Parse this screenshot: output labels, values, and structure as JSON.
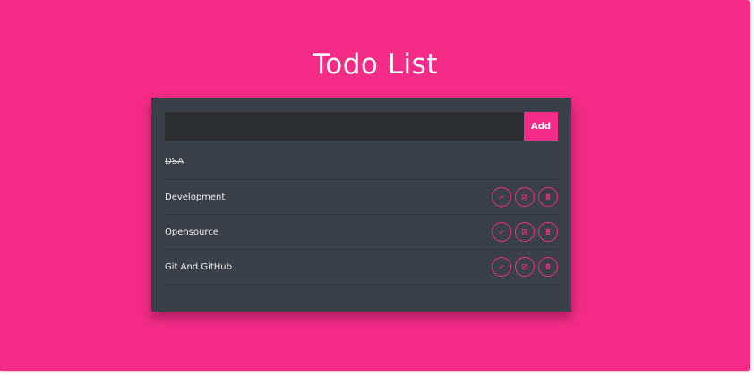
{
  "app": {
    "title": "Todo List"
  },
  "form": {
    "input_value": "",
    "input_placeholder": "",
    "add_label": "Add"
  },
  "todos": [
    {
      "text": "DSA",
      "completed": true
    },
    {
      "text": "Development",
      "completed": false
    },
    {
      "text": "Opensource",
      "completed": false
    },
    {
      "text": "Git And GitHub",
      "completed": false
    }
  ],
  "icons": {
    "complete": "check-icon",
    "edit": "edit-icon",
    "delete": "trash-icon"
  },
  "colors": {
    "background": "#f42c87",
    "card": "#3a4049",
    "input": "#2b2e33",
    "accent": "#f42c87",
    "text": "#eef0f2"
  }
}
